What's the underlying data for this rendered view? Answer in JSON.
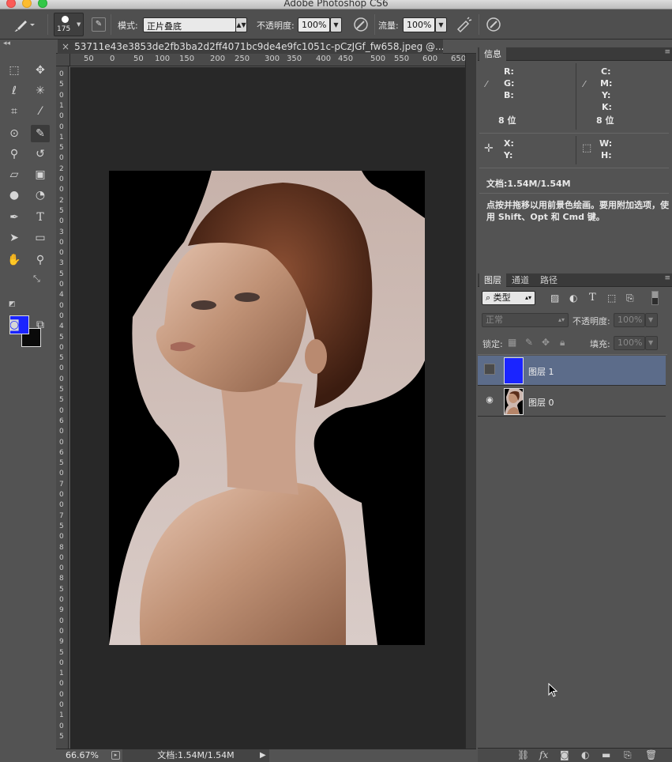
{
  "app": {
    "title": "Adobe Photoshop CS6"
  },
  "options": {
    "brush_size": "175",
    "mode_label": "模式:",
    "mode_value": "正片叠底",
    "opacity_label": "不透明度:",
    "opacity_value": "100%",
    "flow_label": "流量:",
    "flow_value": "100%"
  },
  "document": {
    "tab_title": "53711e43e3853de2fb3ba2d2ff4071bc9de4e9fc1051c-pCzJGf_fw658.jpeg @...",
    "ruler_h": [
      "50",
      "0",
      "50",
      "100",
      "150",
      "200",
      "250",
      "300",
      "350",
      "400",
      "450",
      "500",
      "550",
      "600",
      "650"
    ],
    "ruler_v": [
      "0",
      "5",
      "0",
      "1",
      "0",
      "0",
      "1",
      "5",
      "0",
      "2",
      "0",
      "0",
      "2",
      "5",
      "0",
      "3",
      "0",
      "0",
      "3",
      "5",
      "0",
      "4",
      "0",
      "0",
      "4",
      "5",
      "0",
      "5",
      "0",
      "0",
      "5",
      "5",
      "0",
      "6",
      "0",
      "0",
      "6",
      "5",
      "0",
      "7",
      "0",
      "0",
      "7",
      "5",
      "0",
      "8",
      "0",
      "0",
      "8",
      "5",
      "0",
      "9",
      "0",
      "0",
      "9",
      "5",
      "0",
      "1",
      "0",
      "0",
      "0",
      "1",
      "0",
      "5"
    ],
    "zoom": "66.67%",
    "doc_size": "文档:1.54M/1.54M"
  },
  "info_panel": {
    "tab": "信息",
    "rgb": [
      "R:",
      "G:",
      "B:"
    ],
    "cmyk": [
      "C:",
      "M:",
      "Y:",
      "K:"
    ],
    "bit_left": "8 位",
    "bit_right": "8 位",
    "xy": [
      "X:",
      "Y:"
    ],
    "wh": [
      "W:",
      "H:"
    ],
    "doc_size": "文档:1.54M/1.54M",
    "hint": "点按并拖移以用前景色绘画。要用附加选项，使用 Shift、Opt 和 Cmd 键。"
  },
  "layers_panel": {
    "tabs": [
      "图层",
      "通道",
      "路径"
    ],
    "filter_label": "类型",
    "blend_mode": "正常",
    "opacity_label": "不透明度:",
    "opacity_value": "100%",
    "lock_label": "锁定:",
    "fill_label": "填充:",
    "fill_value": "100%",
    "layers": [
      {
        "name": "图层 1",
        "color": "#1a24ff",
        "visible": false,
        "selected": true
      },
      {
        "name": "图层 0",
        "visible": true,
        "selected": false
      }
    ]
  },
  "colors": {
    "foreground": "#1a24ff",
    "background": "#0a0a0a"
  }
}
